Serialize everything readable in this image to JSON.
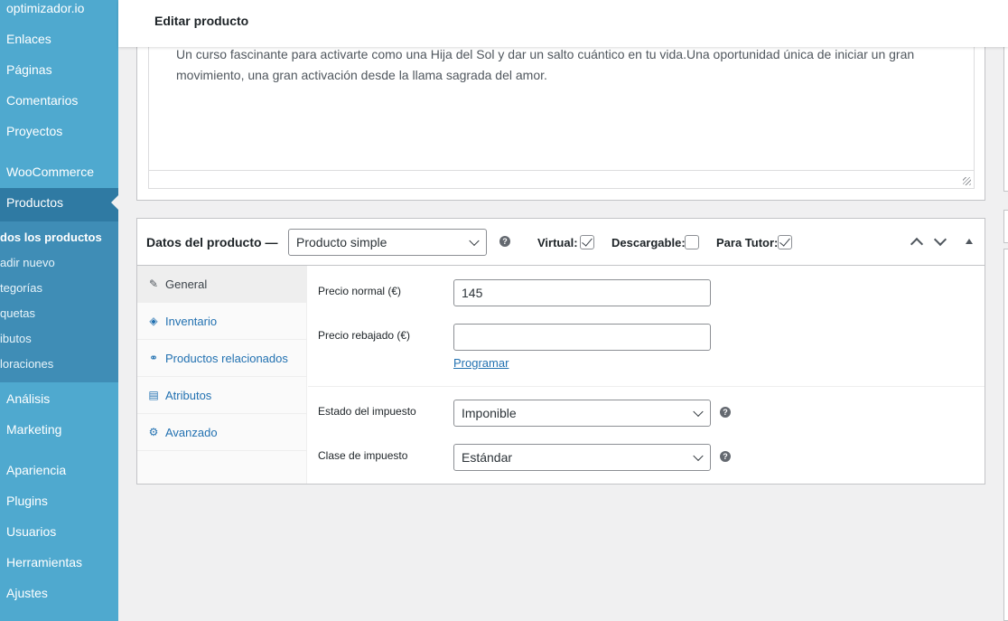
{
  "sidebar": {
    "top_items": [
      "optimizador.io",
      "Enlaces",
      "Páginas",
      "Comentarios",
      "Proyectos",
      "WooCommerce",
      "Productos"
    ],
    "submenu": [
      "dos los productos",
      "adir nuevo",
      "tegorías",
      "quetas",
      "ibutos",
      "loraciones"
    ],
    "bottom_items": [
      "Análisis",
      "Marketing",
      "Apariencia",
      "Plugins",
      "Usuarios",
      "Herramientas",
      "Ajustes"
    ]
  },
  "topbar": {
    "title": "Editar producto"
  },
  "editor": {
    "text": "Un curso fascinante para activarte como una Hija del Sol y dar un salto cuántico en tu vida.Una oportunidad única de iniciar un gran movimiento, una gran activación desde la llama sagrada del amor."
  },
  "product_data": {
    "title": "Datos del producto —",
    "type_select": "Producto simple",
    "virtual_label": "Virtual:",
    "virtual_checked": true,
    "downloadable_label": "Descargable:",
    "downloadable_checked": false,
    "tutor_label": "Para Tutor:",
    "tutor_checked": true,
    "tabs": [
      {
        "label": "General",
        "icon": "wrench-icon"
      },
      {
        "label": "Inventario",
        "icon": "tag-icon"
      },
      {
        "label": "Productos relacionados",
        "icon": "link-icon"
      },
      {
        "label": "Atributos",
        "icon": "list-icon"
      },
      {
        "label": "Avanzado",
        "icon": "gear-icon"
      }
    ],
    "active_tab": "General",
    "fields": {
      "regular_price_label": "Precio normal (€)",
      "regular_price_value": "145",
      "sale_price_label": "Precio rebajado (€)",
      "sale_price_value": "",
      "schedule_link": "Programar",
      "tax_status_label": "Estado del impuesto",
      "tax_status_value": "Imponible",
      "tax_class_label": "Clase de impuesto",
      "tax_class_value": "Estándar"
    }
  },
  "colors": {
    "sidebar": "#4fa9cf",
    "sidebar_current": "#2f7aa3",
    "link": "#2271b1"
  }
}
